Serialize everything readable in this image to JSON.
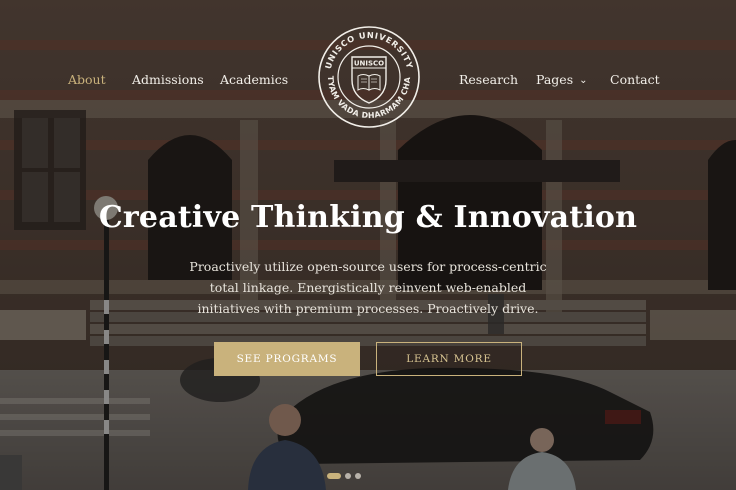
{
  "nav": {
    "left": [
      {
        "label": "About",
        "active": true
      },
      {
        "label": "Admissions"
      },
      {
        "label": "Academics"
      }
    ],
    "right": [
      {
        "label": "Research"
      },
      {
        "label": "Pages"
      },
      {
        "label": "Contact"
      }
    ]
  },
  "logo": {
    "top_text": "UNISCO UNIVERSITY",
    "badge_text": "UNISCO",
    "motto": "SATYAM VADA DHARMAM CHARA"
  },
  "hero": {
    "headline": "Creative Thinking & Innovation",
    "subtext": "Proactively utilize open-source users for process-centric total linkage. Energistically reinvent web-enabled initiatives with premium processes. Proactively drive.",
    "buttons": {
      "primary": "SEE PROGRAMS",
      "secondary": "LEARN MORE"
    }
  },
  "slider": {
    "count": 3,
    "active_index": 0
  },
  "colors": {
    "accent": "#c9b27c",
    "text_light": "#f2efe9",
    "overlay": "rgba(20,18,16,0.48)"
  }
}
